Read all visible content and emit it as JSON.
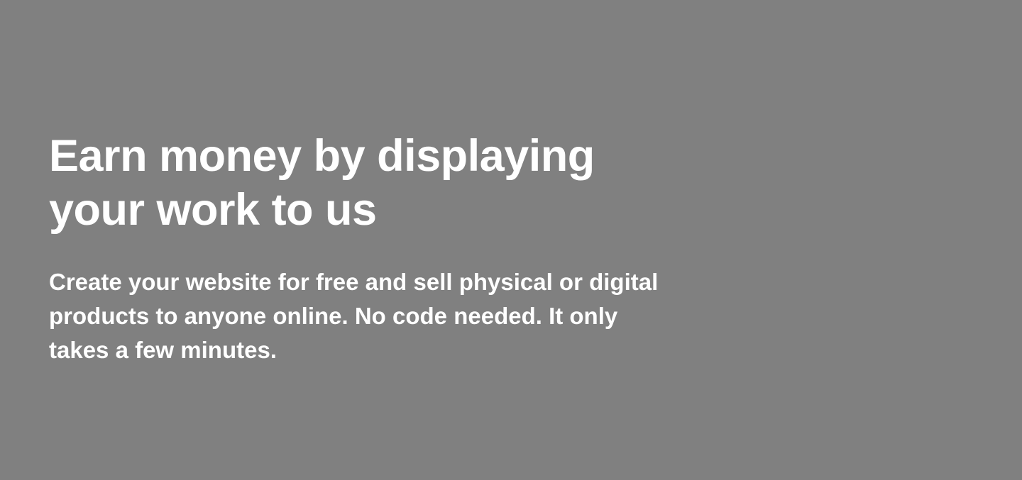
{
  "hero": {
    "title_lines": [
      "Earn money by displaying",
      "your work to us"
    ],
    "subtitle_lines": [
      "Create your website for free and sell physical or digital",
      "products to anyone online. No code needed. It only",
      "takes a few minutes."
    ]
  },
  "colors": {
    "background": "#808080",
    "text": "#ffffff"
  }
}
